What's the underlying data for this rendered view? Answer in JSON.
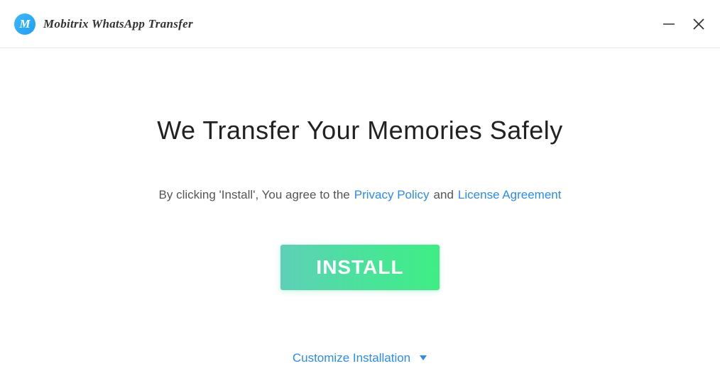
{
  "header": {
    "logo_letter": "M",
    "brand_name": "Mobitrix WhatsApp Transfer"
  },
  "main": {
    "headline": "We Transfer Your Memories Safely",
    "agreement_prefix": "By clicking 'Install', You agree to the",
    "privacy_link": "Privacy Policy",
    "and_text": "and",
    "license_link": "License Agreement",
    "install_button": "INSTALL"
  },
  "footer": {
    "customize_label": "Customize Installation"
  }
}
